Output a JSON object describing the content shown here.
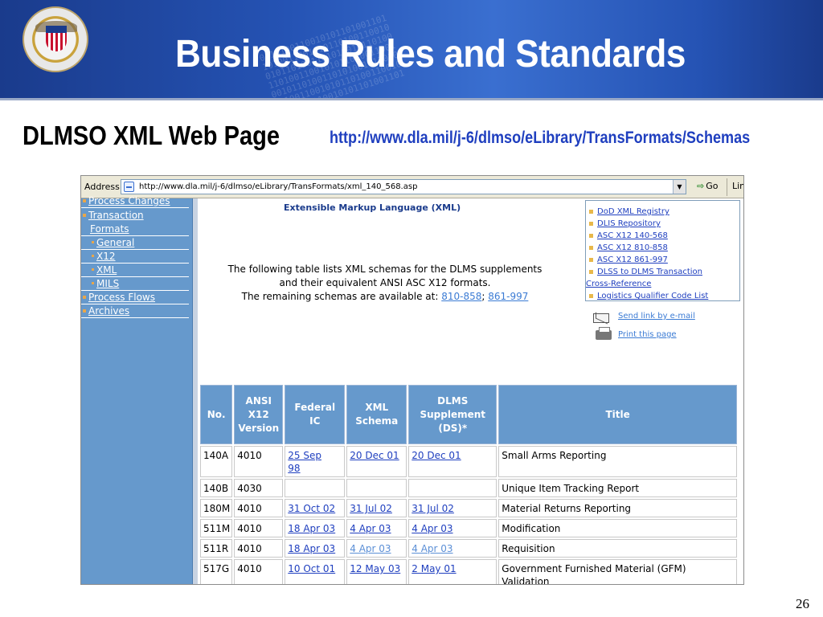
{
  "slide": {
    "title": "Business Rules and Standards",
    "subtitle": "DLMSO XML Web Page",
    "url": "http://www.dla.mil/j-6/dlmso/eLibrary/TransFormats/Schemas",
    "page_number": "26"
  },
  "browser": {
    "address_label": "Address",
    "address_value": "http://www.dla.mil/j-6/dlmso/eLibrary/TransFormats/xml_140_568.asp",
    "go_label": "Go",
    "links_label": "Lin"
  },
  "sidebar": {
    "items": [
      {
        "label": "Process Changes"
      },
      {
        "label": "Transaction"
      },
      {
        "label": "Formats"
      },
      {
        "label": "General"
      },
      {
        "label": "X12"
      },
      {
        "label": "XML"
      },
      {
        "label": "MILS"
      },
      {
        "label": "Process Flows"
      },
      {
        "label": "Archives"
      }
    ]
  },
  "content": {
    "heading": "Extensible Markup Language (XML)",
    "intro_line1": "The following table lists XML schemas for the DLMS supplements",
    "intro_line2": "and their equivalent ANSI ASC X12 formats.",
    "intro_line3": "The remaining schemas are available at: ",
    "intro_link1": "810-858",
    "intro_sep": ";",
    "intro_link2": "861-997"
  },
  "related_links": [
    "DoD XML Registry",
    "DLIS Repository",
    "ASC X12 140-568",
    "ASC X12 810-858",
    "ASC X12 861-997",
    "DLSS to DLMS Transaction",
    "Cross-Reference",
    "Logistics Qualifier Code List"
  ],
  "utility": {
    "email": "Send link by e-mail",
    "print": "Print this page"
  },
  "table": {
    "headers": {
      "no": "No.",
      "ansi_1": "ANSI",
      "ansi_2": "X12",
      "ansi_3": "Version",
      "fic_1": "Federal",
      "fic_2": "IC",
      "xml_1": "XML",
      "xml_2": "Schema",
      "dlms_1": "DLMS",
      "dlms_2": "Supplement",
      "dlms_3": "(DS)*",
      "title": "Title"
    },
    "rows": [
      {
        "no": "140A",
        "ver": "4010",
        "fic_1": "25 Sep",
        "fic_2": "98",
        "xml": "20 Dec 01",
        "ds": "20 Dec 01",
        "title_1": "Small Arms Reporting",
        "title_2": ""
      },
      {
        "no": "140B",
        "ver": "4030",
        "fic_1": "",
        "fic_2": "",
        "xml": "",
        "ds": "",
        "title_1": "Unique Item Tracking Report",
        "title_2": ""
      },
      {
        "no": "180M",
        "ver": "4010",
        "fic_1": "31 Oct 02",
        "fic_2": "",
        "xml": "31 Jul 02",
        "ds": "31 Jul 02",
        "title_1": "Material Returns Reporting",
        "title_2": ""
      },
      {
        "no": "511M",
        "ver": "4010",
        "fic_1": "18 Apr 03",
        "fic_2": "",
        "xml": "4 Apr 03",
        "ds": "4 Apr 03",
        "title_1": "Modification",
        "title_2": ""
      },
      {
        "no": "511R",
        "ver": "4010",
        "fic_1": "18 Apr 03",
        "fic_2": "",
        "xml": "4 Apr 03",
        "ds": "4 Apr 03",
        "title_1": "Requisition",
        "title_2": ""
      },
      {
        "no": "517G",
        "ver": "4010",
        "fic_1": "10 Oct 01",
        "fic_2": "",
        "xml": "12 May 03",
        "ds": "2 May 01",
        "title_1": "Government Furnished Material (GFM)",
        "title_2": "Validation"
      }
    ]
  }
}
